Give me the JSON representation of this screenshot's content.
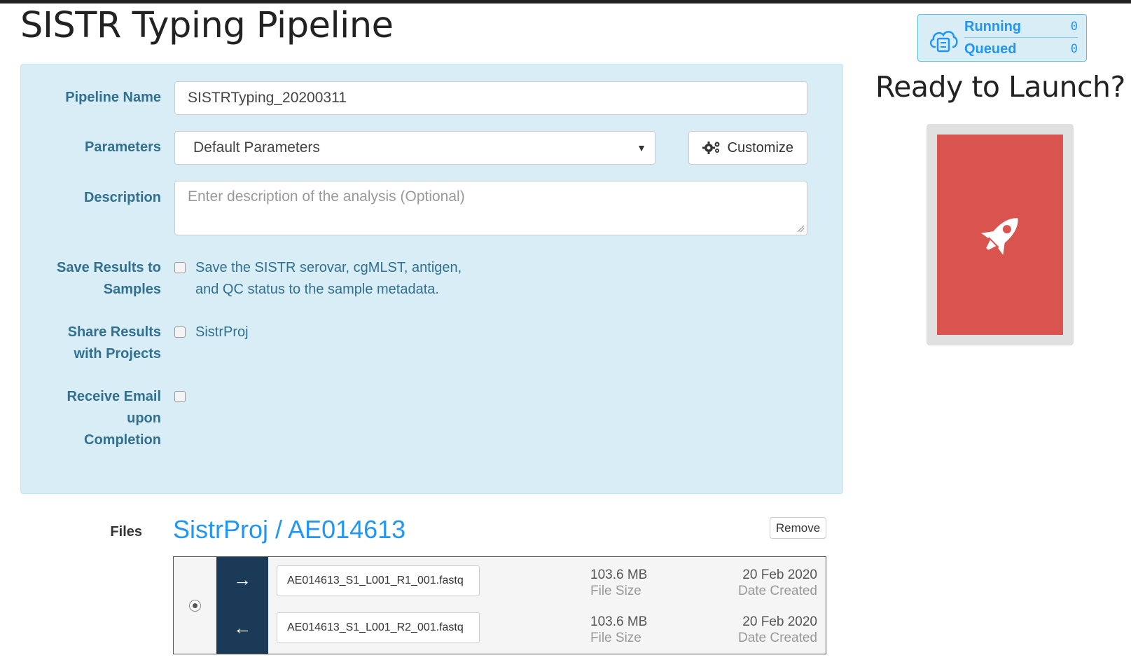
{
  "page": {
    "title": "SISTR Typing Pipeline"
  },
  "form": {
    "pipeline_name_label": "Pipeline Name",
    "pipeline_name_value": "SISTRTyping_20200311",
    "parameters_label": "Parameters",
    "parameters_selected": "Default Parameters",
    "customize_label": "Customize",
    "description_label": "Description",
    "description_placeholder": "Enter description of the analysis (Optional)",
    "save_results_label_line1": "Save Results to",
    "save_results_label_line2": "Samples",
    "save_results_text_line1": "Save the SISTR serovar, cgMLST, antigen,",
    "save_results_text_line2": "and QC status to the sample metadata.",
    "share_label_line1": "Share Results",
    "share_label_line2": "with Projects",
    "share_project": "SistrProj",
    "email_label_line1": "Receive Email",
    "email_label_line2": "upon",
    "email_label_line3": "Completion"
  },
  "status": {
    "running_label": "Running",
    "running_count": "0",
    "queued_label": "Queued",
    "queued_count": "0"
  },
  "launch": {
    "title": "Ready to Launch?"
  },
  "files": {
    "label": "Files",
    "sample_link": "SistrProj / AE014613",
    "remove_label": "Remove",
    "rows": [
      {
        "direction": "→",
        "filename": "AE014613_S1_L001_R1_001.fastq",
        "size": "103.6 MB",
        "size_caption": "File Size",
        "date": "20 Feb 2020",
        "date_caption": "Date Created"
      },
      {
        "direction": "←",
        "filename": "AE014613_S1_L001_R2_001.fastq",
        "size": "103.6 MB",
        "size_caption": "File Size",
        "date": "20 Feb 2020",
        "date_caption": "Date Created"
      }
    ]
  },
  "colors": {
    "panel_bg": "#d9edf7",
    "label_text": "#31708f",
    "link_blue": "#2196f3",
    "launch_red": "#d9534f",
    "arrow_col_bg": "#1b3a57"
  },
  "icons": {
    "status": "cloud-server-icon",
    "customize": "gears-icon",
    "launch": "rocket-icon"
  }
}
